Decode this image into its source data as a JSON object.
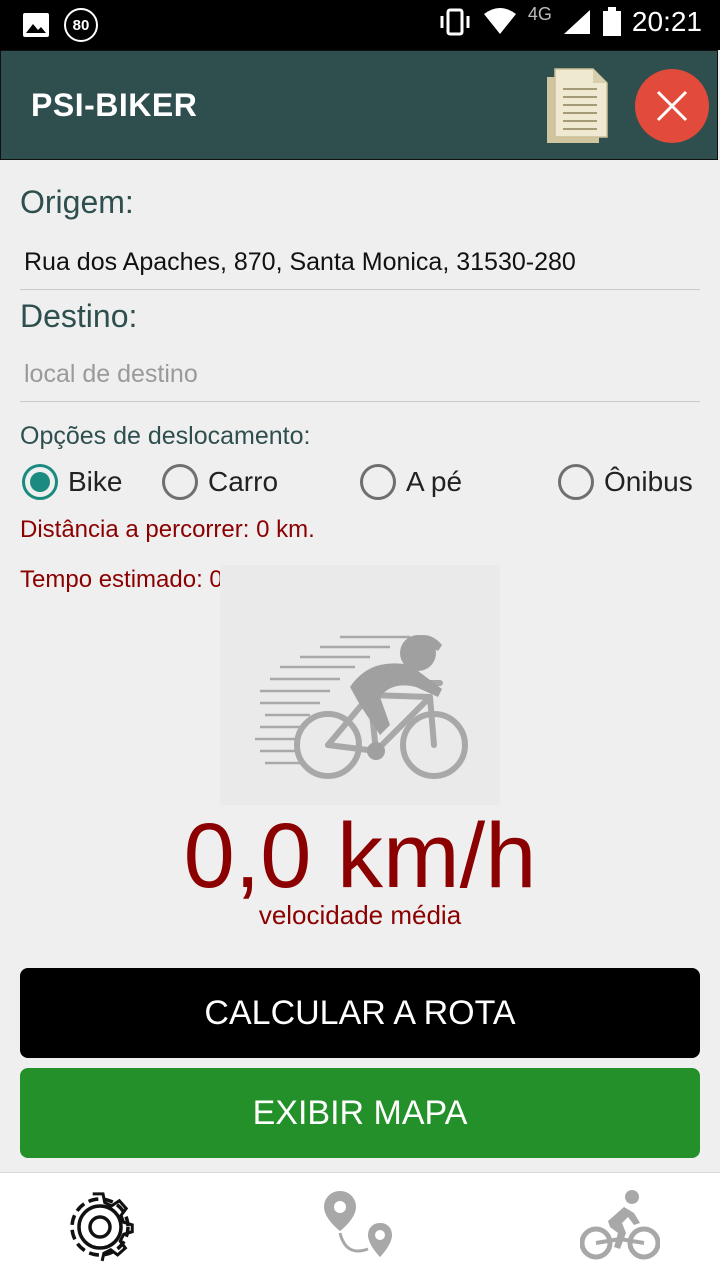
{
  "status_bar": {
    "badge": "80",
    "network": "4G",
    "time": "20:21"
  },
  "app_bar": {
    "title": "PSI-BIKER",
    "icons": [
      "document-icon",
      "close-icon"
    ]
  },
  "form": {
    "origin_label": "Origem:",
    "origin_value": "Rua dos Apaches, 870, Santa Monica, 31530-280",
    "destination_label": "Destino:",
    "destination_placeholder": "local de destino",
    "options_label": "Opções de deslocamento:",
    "transport_options": [
      {
        "label": "Bike",
        "checked": true
      },
      {
        "label": "Carro",
        "checked": false
      },
      {
        "label": "A pé",
        "checked": false
      },
      {
        "label": "Ônibus",
        "checked": false
      }
    ],
    "distance_text": "Distância a percorrer: 0 km.",
    "time_text": "Tempo estimado: 0 h."
  },
  "speed": {
    "value": "0,0 km/h",
    "caption": "velocidade média"
  },
  "buttons": {
    "calculate": "CALCULAR A ROTA",
    "show_map": "EXIBIR MAPA"
  },
  "bottom_nav": {
    "items": [
      "settings-gear-icon",
      "route-pin-icon",
      "cyclist-icon"
    ]
  },
  "colors": {
    "app_bar": "#2f4f4f",
    "accent_red": "#8b0000",
    "radio_checked": "#1b8a7f",
    "green_button": "#23902a",
    "close_button": "#e24b3b"
  }
}
